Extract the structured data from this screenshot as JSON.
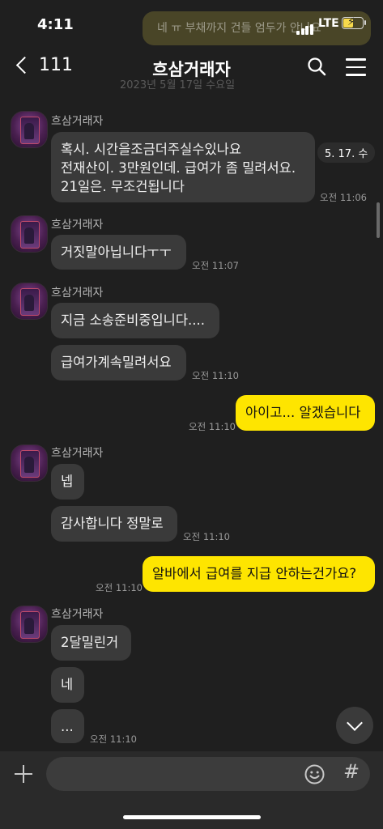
{
  "status_bar": {
    "time": "4:11",
    "network": "LTE"
  },
  "notification_ghost": "네 ㅠ 부채까지 건들 엄두가 안나요",
  "header": {
    "back_count": "111",
    "title": "흐삼거래자",
    "date_ghost": "2023년 5월 17일 수요일"
  },
  "date_badge": "5. 17. 수",
  "messages": [
    {
      "sender": "흐삼거래자",
      "text": "혹시. 시간을조금더주실수있나요\n전재산이. 3만원인데. 급여가 좀 밀려서요.\n21일은. 무조건됩니다",
      "time": "오전 11:06"
    },
    {
      "sender": "흐삼거래자",
      "text": "거짓말아닙니다ㅜㅜ",
      "time": "오전 11:07"
    },
    {
      "sender": "흐삼거래자",
      "text": "지금 소송준비중입니다....",
      "time": ""
    },
    {
      "sender": "",
      "text": "급여가계속밀려서요",
      "time": "오전 11:10"
    },
    {
      "sender": "me",
      "text": "아이고... 알겠습니다",
      "time": "오전 11:10"
    },
    {
      "sender": "흐삼거래자",
      "text": "넵",
      "time": ""
    },
    {
      "sender": "",
      "text": "감사합니다 정말로",
      "time": "오전 11:10"
    },
    {
      "sender": "me",
      "text": "알바에서 급여를 지급 안하는건가요?",
      "time": "오전 11:10"
    },
    {
      "sender": "흐삼거래자",
      "text": "2달밀린거",
      "time": ""
    },
    {
      "sender": "",
      "text": "네",
      "time": ""
    },
    {
      "sender": "",
      "text": "...",
      "time": "오전 11:10"
    }
  ],
  "input": {
    "placeholder": ""
  },
  "icons": [
    "back-chevron-icon",
    "search-icon",
    "menu-icon",
    "plus-icon",
    "emoji-icon",
    "hash-icon",
    "chevron-down-icon"
  ]
}
